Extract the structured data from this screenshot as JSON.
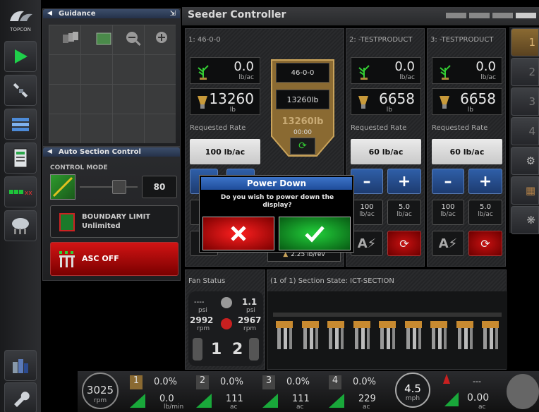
{
  "app": {
    "brand": "TOPCON",
    "title": "Seeder Controller"
  },
  "guidance": {
    "title": "Guidance"
  },
  "asc": {
    "title": "Auto Section Control",
    "control_mode_label": "CONTROL MODE",
    "slider_value": "80",
    "boundary_label": "BOUNDARY LIMIT",
    "boundary_value": "Unlimited",
    "asc_label": "ASC OFF"
  },
  "products": [
    {
      "name": "1: 46-0-0",
      "rate": "0.0",
      "rate_unit": "lb/ac",
      "amount": "13260",
      "amount_unit": "lb",
      "requested_label": "Requested Rate",
      "requested_value": "100 lb/ac"
    },
    {
      "name": "2: -TESTPRODUCT",
      "rate": "0.0",
      "rate_unit": "lb/ac",
      "amount": "6658",
      "amount_unit": "lb",
      "requested_label": "Requested Rate",
      "requested_value": "60 lb/ac",
      "step_value": "100",
      "step_unit": "lb/ac",
      "inc_value": "5.0",
      "inc_unit": "lb/ac"
    },
    {
      "name": "3: -TESTPRODUCT",
      "rate": "0.0",
      "rate_unit": "lb/ac",
      "amount": "6658",
      "amount_unit": "lb",
      "requested_label": "Requested Rate",
      "requested_value": "60 lb/ac",
      "step_value": "100",
      "step_unit": "lb/ac",
      "inc_value": "5.0",
      "inc_unit": "lb/ac"
    }
  ],
  "tank": {
    "product": "46-0-0",
    "weight": "13260lb",
    "overlay": "13260lb",
    "time": "00:00",
    "cal": "2.25 lb/rev"
  },
  "dialog": {
    "title": "Power Down",
    "message": "Do you wish to power down the display?"
  },
  "fan": {
    "title": "Fan Status",
    "psi_left": "----",
    "psi_left_unit": "psi",
    "psi_right": "1.1",
    "psi_right_unit": "psi",
    "rpm_left": "2992",
    "rpm_left_unit": "rpm",
    "rpm_right": "2967",
    "rpm_right_unit": "rpm",
    "fan1": "1",
    "fan2": "2"
  },
  "section_state": {
    "title": "(1 of 1) Section State: ICT-SECTION",
    "rows": 9
  },
  "bottom": {
    "rpm": "3025",
    "rpm_unit": "rpm",
    "flow": "0.0",
    "flow_unit": "lb/min",
    "speed": "4.5",
    "speed_unit": "mph",
    "area": "0.00",
    "area_unit": "ac",
    "area_top": "---",
    "prods": [
      {
        "num": "1",
        "pct": "0.0%",
        "ac": "0.0",
        "unit": "lb/min"
      },
      {
        "num": "2",
        "pct": "0.0%",
        "ac": "111",
        "unit": "ac"
      },
      {
        "num": "3",
        "pct": "0.0%",
        "ac": "111",
        "unit": "ac"
      },
      {
        "num": "4",
        "pct": "0.0%",
        "ac": "229",
        "unit": "ac"
      }
    ]
  },
  "right_bar": [
    "1",
    "2",
    "3",
    "4"
  ],
  "colors": {
    "accent": "#1e4f9c",
    "ok_green": "#0c9b2a",
    "cancel_red": "#d01010",
    "brass": "#8a6a32"
  }
}
